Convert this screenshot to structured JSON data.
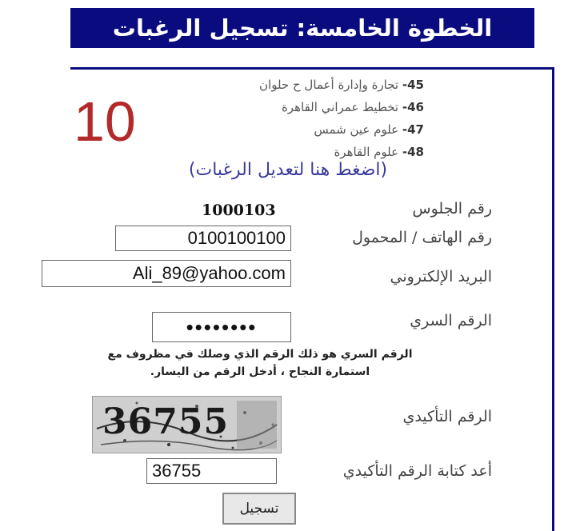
{
  "header": {
    "title": "الخطوة الخامسة: تسجيل الرغبات"
  },
  "wishes": [
    {
      "num": "45-",
      "text": "تجارة وإدارة أعمال ح حلوان"
    },
    {
      "num": "46-",
      "text": "تخطيط عمراني القاهرة"
    },
    {
      "num": "47-",
      "text": "علوم عين شمس"
    },
    {
      "num": "48-",
      "text": "علوم القاهرة"
    }
  ],
  "count": "10",
  "edit_link": "(اضغط هنا لتعديل الرغبات)",
  "form": {
    "seat_label": "رقم الجلوس",
    "seat_value": "1000103",
    "phone_label": "رقم الهاتف / المحمول",
    "phone_value": "0100100100",
    "email_label": "البريد الإلكتروني",
    "email_value": "Ali_89@yahoo.com",
    "password_label": "الرقم السري",
    "password_value": "••••••••",
    "password_note_line1": "الرقم السري هو ذلك الرقم الذي وصلك في مظروف مع",
    "password_note_line2": "استمارة النجاح ، أدخل الرقم من اليسار.",
    "captcha_label": "الرقم التأكيدي",
    "captcha_image_text": "36755",
    "confirm_label": "أعد كتابة الرقم التأكيدي",
    "confirm_value": "36755",
    "submit_label": "تسجيل"
  },
  "colors": {
    "header_bg": "#0b0b80",
    "count_red": "#b22a2a",
    "link_blue": "#3a3a9c"
  }
}
